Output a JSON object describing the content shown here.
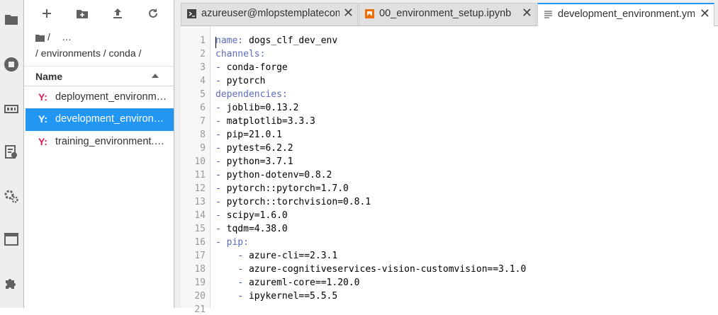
{
  "activity_bar": {
    "icons": [
      "folder-icon",
      "running-icon",
      "commands-icon",
      "property-inspector-icon",
      "settings-icon",
      "tabs-icon",
      "extensions-icon"
    ]
  },
  "file_browser": {
    "toolbar": [
      "new-launcher-icon",
      "new-folder-icon",
      "upload-icon",
      "refresh-icon"
    ],
    "breadcrumb_root": "/",
    "breadcrumb_more": "…",
    "path": "/ environments / conda /",
    "column_header": "Name",
    "files": [
      {
        "icon_text": "Y:",
        "name": "deployment_environment.yml",
        "selected": false
      },
      {
        "icon_text": "Y:",
        "name": "development_environment.yml",
        "selected": true
      },
      {
        "icon_text": "Y:",
        "name": "training_environment.yml",
        "selected": false
      }
    ]
  },
  "tabs": [
    {
      "label": "azureuser@mlopstemplatecompute",
      "icon": "terminal-icon",
      "active": false
    },
    {
      "label": "00_environment_setup.ipynb",
      "icon": "notebook-icon",
      "active": false
    },
    {
      "label": "development_environment.yml",
      "icon": "text-file-icon",
      "active": true
    }
  ],
  "editor": {
    "lines": [
      {
        "n": "1",
        "parts": [
          [
            "k",
            "name:"
          ],
          [
            "t",
            " dogs_clf_dev_env"
          ]
        ]
      },
      {
        "n": "2",
        "parts": [
          [
            "k",
            "channels:"
          ]
        ]
      },
      {
        "n": "3",
        "parts": [
          [
            "d",
            "- "
          ],
          [
            "t",
            "conda-forge"
          ]
        ]
      },
      {
        "n": "4",
        "parts": [
          [
            "d",
            "- "
          ],
          [
            "t",
            "pytorch"
          ]
        ]
      },
      {
        "n": "5",
        "parts": [
          [
            "k",
            "dependencies:"
          ]
        ]
      },
      {
        "n": "6",
        "parts": [
          [
            "d",
            "- "
          ],
          [
            "t",
            "joblib=0.13.2"
          ]
        ]
      },
      {
        "n": "7",
        "parts": [
          [
            "d",
            "- "
          ],
          [
            "t",
            "matplotlib=3.3.3"
          ]
        ]
      },
      {
        "n": "8",
        "parts": [
          [
            "d",
            "- "
          ],
          [
            "t",
            "pip=21.0.1"
          ]
        ]
      },
      {
        "n": "9",
        "parts": [
          [
            "d",
            "- "
          ],
          [
            "t",
            "pytest=6.2.2"
          ]
        ]
      },
      {
        "n": "10",
        "parts": [
          [
            "d",
            "- "
          ],
          [
            "t",
            "python=3.7.1"
          ]
        ]
      },
      {
        "n": "11",
        "parts": [
          [
            "d",
            "- "
          ],
          [
            "t",
            "python-dotenv=0.8.2"
          ]
        ]
      },
      {
        "n": "12",
        "parts": [
          [
            "d",
            "- "
          ],
          [
            "t",
            "pytorch::pytorch=1.7.0"
          ]
        ]
      },
      {
        "n": "13",
        "parts": [
          [
            "d",
            "- "
          ],
          [
            "t",
            "pytorch::torchvision=0.8.1"
          ]
        ]
      },
      {
        "n": "14",
        "parts": [
          [
            "d",
            "- "
          ],
          [
            "t",
            "scipy=1.6.0"
          ]
        ]
      },
      {
        "n": "15",
        "parts": [
          [
            "d",
            "- "
          ],
          [
            "t",
            "tqdm=4.38.0"
          ]
        ]
      },
      {
        "n": "16",
        "parts": [
          [
            "d",
            "- "
          ],
          [
            "k",
            "pip:"
          ]
        ]
      },
      {
        "n": "17",
        "parts": [
          [
            "t",
            "    "
          ],
          [
            "d",
            "- "
          ],
          [
            "t",
            "azure-cli==2.3.1"
          ]
        ]
      },
      {
        "n": "18",
        "parts": [
          [
            "t",
            "    "
          ],
          [
            "d",
            "- "
          ],
          [
            "t",
            "azure-cognitiveservices-vision-customvision==3.1.0"
          ]
        ]
      },
      {
        "n": "19",
        "parts": [
          [
            "t",
            "    "
          ],
          [
            "d",
            "- "
          ],
          [
            "t",
            "azureml-core==1.20.0"
          ]
        ]
      },
      {
        "n": "20",
        "parts": [
          [
            "t",
            "    "
          ],
          [
            "d",
            "- "
          ],
          [
            "t",
            "ipykernel==5.5.5"
          ]
        ]
      },
      {
        "n": "21",
        "parts": []
      }
    ]
  },
  "colors": {
    "accent": "#2196f3",
    "yaml_icon": "#d81b60",
    "yaml_key": "#5c6bc0"
  }
}
